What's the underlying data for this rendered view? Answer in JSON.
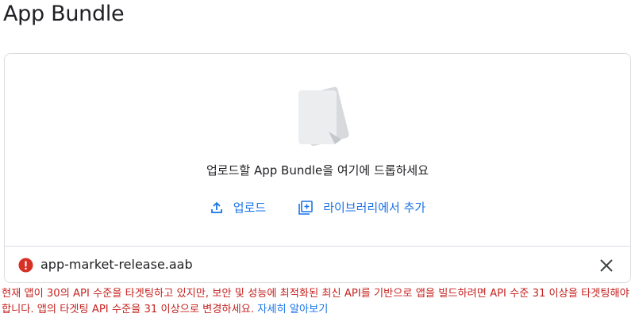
{
  "header": {
    "title": "App Bundle"
  },
  "dropzone": {
    "instruction": "업로드할 App Bundle을 여기에 드롭하세요",
    "upload_label": "업로드",
    "add_from_library_label": "라이브러리에서 추가"
  },
  "file": {
    "name": "app-market-release.aab",
    "status": "error"
  },
  "error": {
    "message": "현재 앱이 30의 API 수준을 타겟팅하고 있지만, 보안 및 성능에 최적화된 최신 API를 기반으로 앱을 빌드하려면 API 수준 31 이상을 타겟팅해야 합니다. 앱의 타겟팅 API 수준을 31 이상으로 변경하세요.",
    "learn_more_label": "자세히 알아보기"
  },
  "colors": {
    "accent": "#1a73e8",
    "error": "#c5221f",
    "border": "#dadce0"
  },
  "icons": [
    "doc-stack-illustration",
    "upload-icon",
    "library-add-icon",
    "error-icon",
    "close-icon"
  ]
}
